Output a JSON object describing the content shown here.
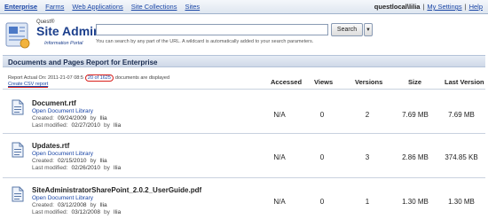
{
  "nav": {
    "items": [
      "Enterprise",
      "Farms",
      "Web Applications",
      "Site Collections",
      "Sites"
    ],
    "user": "questlocal\\lilia",
    "links": [
      "My Settings",
      "Help"
    ],
    "separator": "|"
  },
  "logo": {
    "vendor": "Quest®",
    "title": "Site Admin",
    "subtitle": "Information Portal"
  },
  "search": {
    "value": "",
    "button_label": "Search",
    "hint": "You can search by any part of the URL. A wildcard is automatically added to your search parameters."
  },
  "report": {
    "title": "Documents and Pages Report for Enterprise",
    "info_prefix": "Report Actual On: 2011-21-07 08:5",
    "info_count": "20 of 1625",
    "info_suffix": "documents are displayed",
    "csv_link": "Create CSV report"
  },
  "columns": {
    "accessed": "Accessed",
    "views": "Views",
    "versions": "Versions",
    "size": "Size",
    "last_version": "Last Version"
  },
  "rows": [
    {
      "name": "Document.rtf",
      "library": "Open Document Library",
      "created_label": "Created:",
      "created_date": "09/24/2009",
      "created_by_label": "by",
      "created_by": "Ilia",
      "modified_label": "Last modified:",
      "modified_date": "02/27/2010",
      "modified_by_label": "by",
      "modified_by": "Ilia",
      "accessed": "N/A",
      "views": "0",
      "versions": "2",
      "size": "7.69 MB",
      "last_version": "7.69 MB"
    },
    {
      "name": "Updates.rtf",
      "library": "Open Document Library",
      "created_label": "Created:",
      "created_date": "02/15/2010",
      "created_by_label": "by",
      "created_by": "Ilia",
      "modified_label": "Last modified:",
      "modified_date": "02/26/2010",
      "modified_by_label": "by",
      "modified_by": "Ilia",
      "accessed": "N/A",
      "views": "0",
      "versions": "3",
      "size": "2.86 MB",
      "last_version": "374.85 KB"
    },
    {
      "name": "SiteAdministratorSharePoint_2.0.2_UserGuide.pdf",
      "library": "Open Document Library",
      "created_label": "Created:",
      "created_date": "03/12/2008",
      "created_by_label": "by",
      "created_by": "Ilia",
      "modified_label": "Last modified:",
      "modified_date": "03/12/2008",
      "modified_by_label": "by",
      "modified_by": "Ilia",
      "accessed": "N/A",
      "views": "0",
      "versions": "1",
      "size": "1.30 MB",
      "last_version": "1.30 MB"
    }
  ],
  "colors": {
    "link": "#1a46a6",
    "annotation": "#d8201c",
    "brand": "#1c3f8c"
  }
}
